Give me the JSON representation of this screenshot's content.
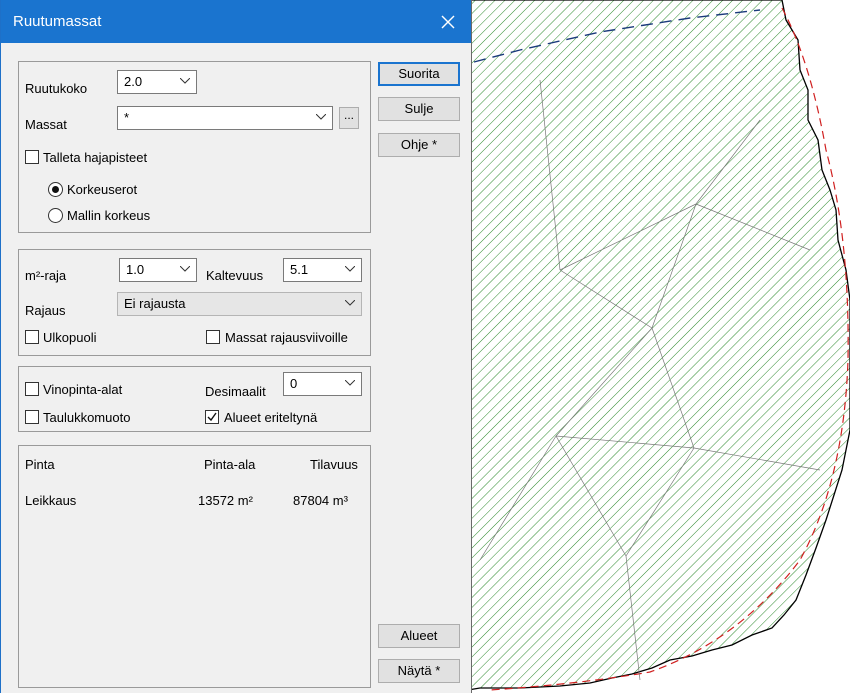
{
  "window": {
    "title": "Ruutumassat"
  },
  "icons": {
    "close": "close-icon",
    "dropdown": "chevron-down-icon",
    "check": "checkmark-icon"
  },
  "colors": {
    "titlebar": "#1a74cf",
    "hatch": "#2e8b2e",
    "boundary": "#d02020",
    "line": "#1a3a7a"
  },
  "section1": {
    "ruutukoko_label": "Ruutukoko",
    "ruutukoko_value": "2.0",
    "massat_label": "Massat",
    "massat_value": "*",
    "browse_label": "...",
    "talleta_label": "Talleta hajapisteet",
    "talleta_checked": false,
    "radio_korkeuserot": "Korkeuserot",
    "radio_mallin": "Mallin korkeus",
    "selected_radio": "Korkeuserot"
  },
  "section2": {
    "m2raja_label": "m²-raja",
    "m2raja_value": "1.0",
    "kaltevuus_label": "Kaltevuus",
    "kaltevuus_value": "5.1",
    "rajaus_label": "Rajaus",
    "rajaus_value": "Ei rajausta",
    "ulkopuoli_label": "Ulkopuoli",
    "ulkopuoli_checked": false,
    "massat_raj_label": "Massat rajausviivoille",
    "massat_raj_checked": false
  },
  "section3": {
    "vinopinta_label": "Vinopinta-alat",
    "vinopinta_checked": false,
    "desimaalit_label": "Desimaalit",
    "desimaalit_value": "0",
    "taulukko_label": "Taulukkomuoto",
    "taulukko_checked": false,
    "alueet_label": "Alueet eriteltynä",
    "alueet_checked": true
  },
  "results": {
    "headers": [
      "Pinta",
      "Pinta-ala",
      "Tilavuus"
    ],
    "rows": [
      {
        "pinta": "Leikkaus",
        "ala": "13572 m²",
        "tilavuus": "87804 m³"
      }
    ]
  },
  "buttons": {
    "suorita": "Suorita",
    "sulje": "Sulje",
    "ohje": "Ohje *",
    "alueet": "Alueet",
    "nayta": "Näytä *"
  }
}
